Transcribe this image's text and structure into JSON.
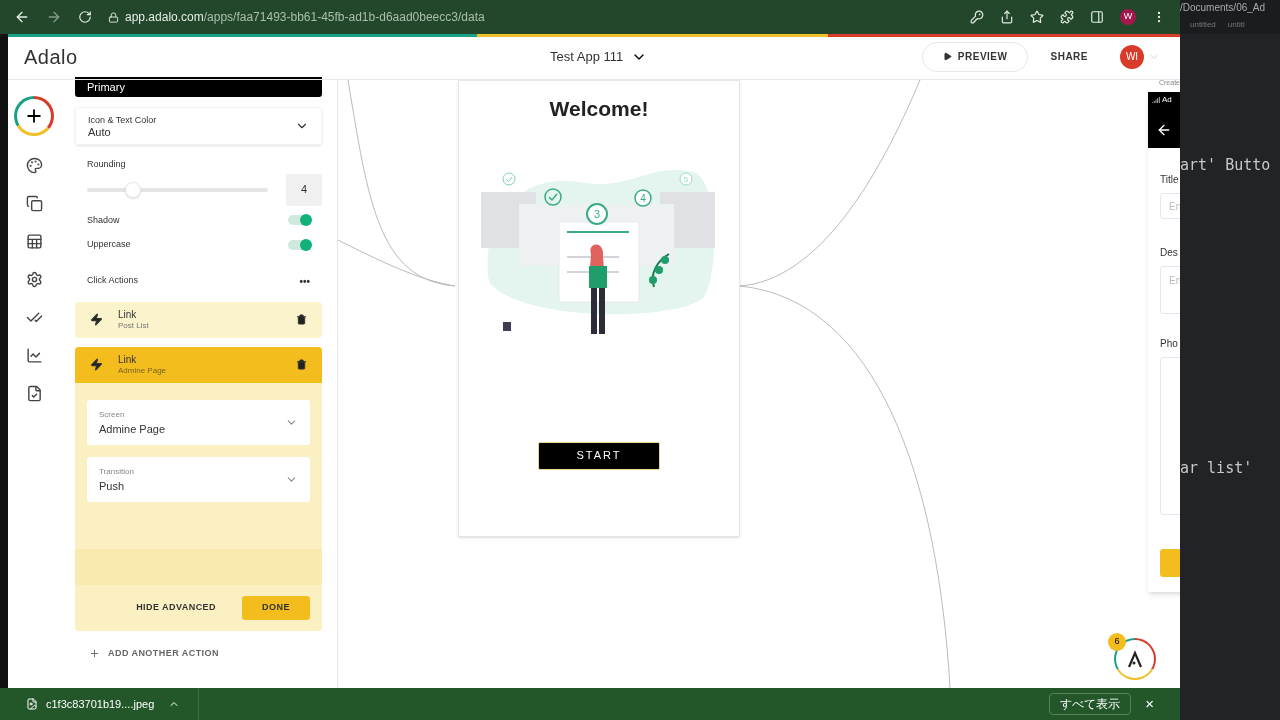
{
  "browser": {
    "url_host": "app.adalo.com",
    "url_path": "/apps/faa71493-bb61-45fb-ad1b-d6aad0beecc3/data",
    "profile_initial": "W"
  },
  "header": {
    "logo": "Adalo",
    "app_title": "Test App 111",
    "preview": "PREVIEW",
    "share": "SHARE",
    "user_initials": "WI"
  },
  "panel": {
    "cut_item": "Primary",
    "color_select": {
      "label": "Icon & Text Color",
      "value": "Auto"
    },
    "rounding": {
      "label": "Rounding",
      "level": 0.23,
      "value": "4"
    },
    "toggles": [
      {
        "label": "Shadow",
        "on": true
      },
      {
        "label": "Uppercase",
        "on": true
      }
    ],
    "click_actions": {
      "title": "Click Actions",
      "more": "•••"
    },
    "actions": [
      {
        "title": "Link",
        "subtitle": "Post List",
        "expanded": false
      },
      {
        "title": "Link",
        "subtitle": "Admine Page",
        "expanded": true,
        "fields": [
          {
            "label": "Screen",
            "value": "Admine Page"
          },
          {
            "label": "Transition",
            "value": "Push"
          }
        ],
        "hide_advanced": "HIDE ADVANCED",
        "done": "DONE"
      }
    ],
    "add_action": "ADD ANOTHER ACTION"
  },
  "canvas": {
    "screen": {
      "heading": "Welcome!",
      "steps": [
        "3",
        "4",
        "5"
      ],
      "button": "START"
    },
    "side_screen": {
      "caption": "Create",
      "status": "Ad",
      "labels": [
        "Title",
        "Des",
        "Pho"
      ],
      "placeholders": [
        "En",
        "En"
      ]
    },
    "help_badge": "6"
  },
  "editor": {
    "path": "/Documents/06_Ad",
    "tabs": [
      "untitled",
      "untitl"
    ],
    "lines": [
      "art' Butto",
      "ar list'"
    ]
  },
  "downloads": {
    "file": "c1f3c83701b19....jpeg",
    "show_all": "すべて表示",
    "close": "×"
  }
}
